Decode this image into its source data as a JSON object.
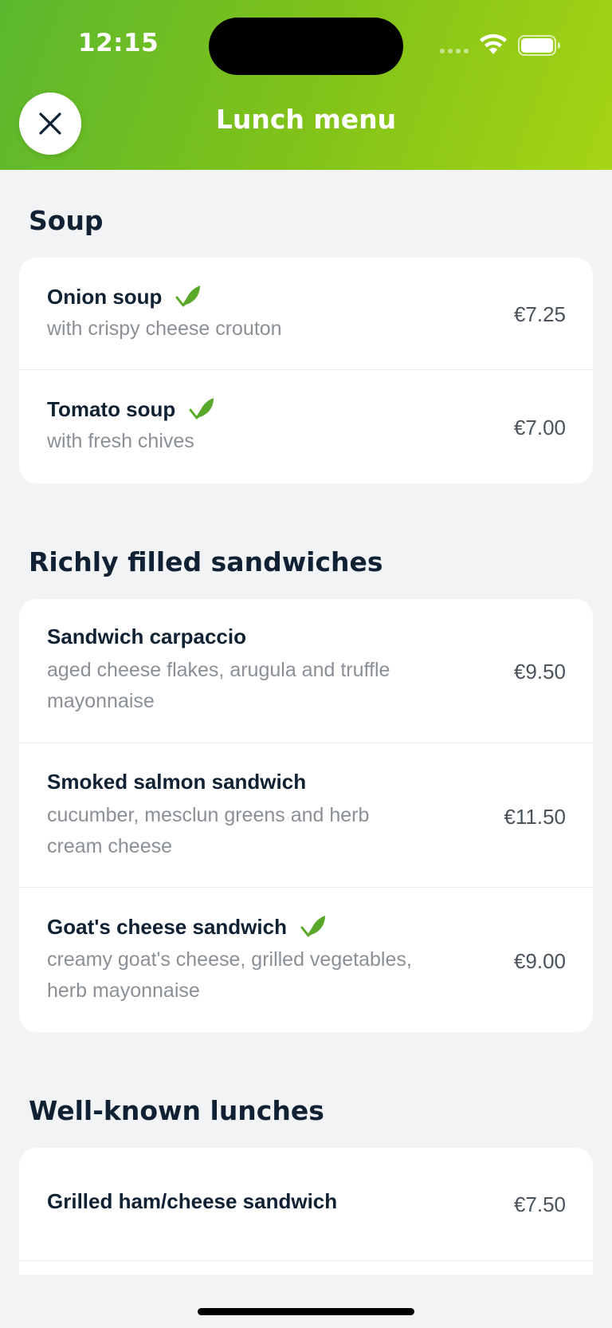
{
  "status_bar": {
    "time": "12:15"
  },
  "header": {
    "title": "Lunch menu"
  },
  "icons": {
    "close": "close-icon",
    "vegetarian": "leaf-icon"
  },
  "colors": {
    "header_start": "#5cb82e",
    "header_end": "#a6d414",
    "leaf": "#5aa829",
    "text_dark": "#0f2133",
    "text_muted": "#8a9096"
  },
  "sections": [
    {
      "title": "Soup",
      "items": [
        {
          "name": "Onion soup",
          "vegetarian": true,
          "description": "with crispy cheese crouton",
          "price": "€7.25"
        },
        {
          "name": "Tomato soup",
          "vegetarian": true,
          "description": "with fresh chives",
          "price": "€7.00"
        }
      ]
    },
    {
      "title": "Richly filled sandwiches",
      "items": [
        {
          "name": "Sandwich carpaccio",
          "vegetarian": false,
          "description_lines": [
            "aged cheese flakes, arugula and truffle",
            "mayonnaise"
          ],
          "price": "€9.50"
        },
        {
          "name": "Smoked salmon sandwich",
          "vegetarian": false,
          "description_lines": [
            "cucumber, mesclun greens and herb",
            "cream cheese"
          ],
          "price": "€11.50"
        },
        {
          "name": "Goat's cheese sandwich",
          "vegetarian": true,
          "description_lines": [
            "creamy goat's cheese, grilled vegetables,",
            "herb mayonnaise"
          ],
          "price": "€9.00"
        }
      ]
    },
    {
      "title": "Well-known lunches",
      "items": [
        {
          "name": "Grilled ham/cheese sandwich",
          "vegetarian": false,
          "price": "€7.50"
        }
      ]
    }
  ]
}
